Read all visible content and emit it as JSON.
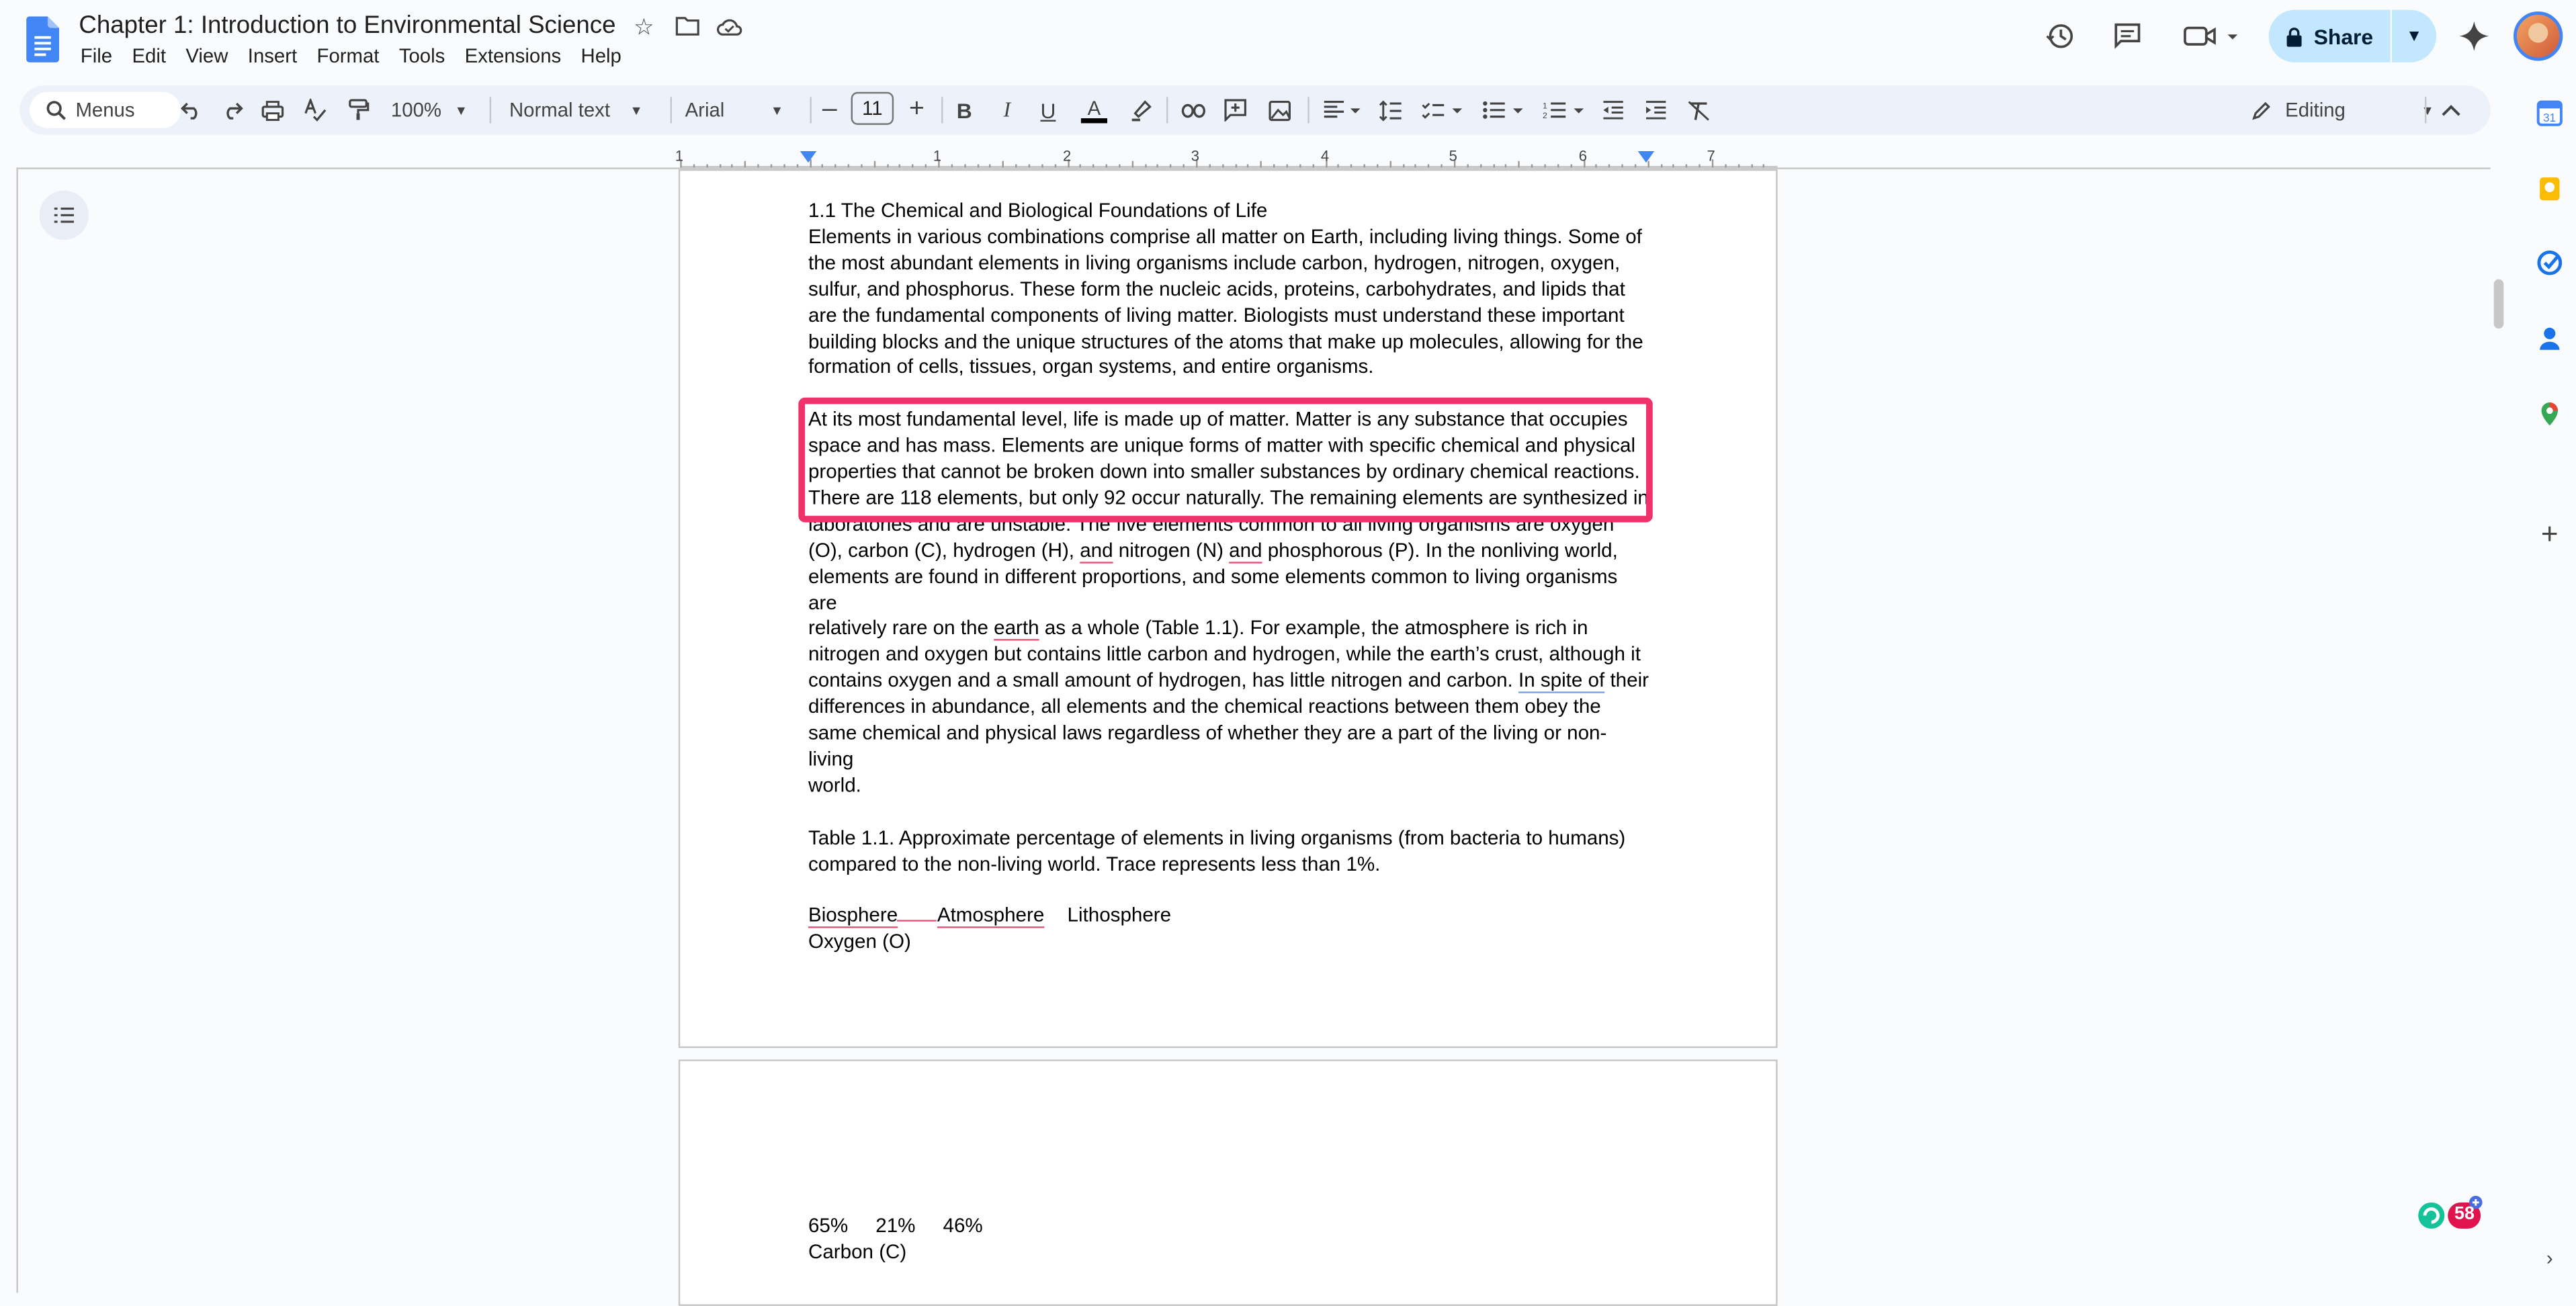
{
  "header": {
    "title": "Chapter 1: Introduction to Environmental Science",
    "menus": [
      "File",
      "Edit",
      "View",
      "Insert",
      "Format",
      "Tools",
      "Extensions",
      "Help"
    ],
    "share_label": "Share"
  },
  "toolbar": {
    "search_label": "Menus",
    "zoom": "100%",
    "style": "Normal text",
    "font": "Arial",
    "font_size": "11",
    "mode": "Editing"
  },
  "ruler": {
    "numbers": [
      "1",
      "1",
      "2",
      "3",
      "4",
      "5",
      "6",
      "7"
    ]
  },
  "document": {
    "heading": "1.1 The Chemical and Biological Foundations of Life",
    "para1_lines": [
      "Elements in various combinations comprise all matter on Earth, including living things. Some of",
      "the most abundant elements in living organisms include carbon, hydrogen, nitrogen, oxygen,",
      "sulfur, and phosphorus. These form the nucleic acids, proteins, carbohydrates, and lipids that",
      "are the fundamental components of living matter. Biologists must understand these important",
      "building blocks and the unique structures of the atoms that make up molecules, allowing for the",
      "formation of cells, tissues, organ systems, and entire organisms."
    ],
    "para2_lines": [
      "At its most fundamental level, life is made up of matter. Matter is any substance that occupies",
      "space and has mass. Elements are unique forms of matter with specific chemical and physical",
      "properties that cannot be broken down into smaller substances by ordinary chemical reactions.",
      "There are 118 elements, but only 92 occur naturally. The remaining elements are synthesized in",
      "laboratories and are unstable. The five elements common to all living organisms are oxygen"
    ],
    "para2_line6_a": "(O), carbon (C), hydrogen (H), ",
    "para2_line6_and1": "and",
    "para2_line6_b": " nitrogen (N) ",
    "para2_line6_and2": "and",
    "para2_line6_c": " phosphorous (P). In the nonliving world,",
    "para2_line7": "elements are found in different proportions, and some elements common to living organisms are",
    "para2_line8_a": "relatively rare on the ",
    "para2_line8_earth": "earth",
    "para2_line8_b": " as a whole (Table 1.1). For example, the atmosphere is rich in",
    "para2_line9": "nitrogen and oxygen but contains little carbon and hydrogen, while the earth’s crust, although it",
    "para2_line10_a": "contains oxygen and a small amount of hydrogen, has little nitrogen and carbon. ",
    "para2_line10_inspite": "In spite of",
    "para2_line10_b": " their",
    "para2_line11": "differences in abundance, all elements and the chemical reactions between them obey the",
    "para2_line12": "same chemical and physical laws regardless of whether they are a part of the living or non-living",
    "para2_line13": "world.",
    "table_caption_1": "Table 1.1. Approximate percentage of elements in living organisms (from bacteria to humans)",
    "table_caption_2": "compared to the non-living world. Trace represents less than 1%.",
    "table_header": {
      "c1": "Biosphere",
      "c2": "Atmosphere",
      "c3": "Lithosphere"
    },
    "row1_label": "Oxygen (O)",
    "row1_values": "65%     21%     46%",
    "row2_label": "Carbon (C)"
  },
  "badge": {
    "count": "58"
  },
  "colors": {
    "highlight": "#f0326a",
    "share_bg": "#c2e7ff",
    "toolbar_bg": "#edf2fa"
  }
}
